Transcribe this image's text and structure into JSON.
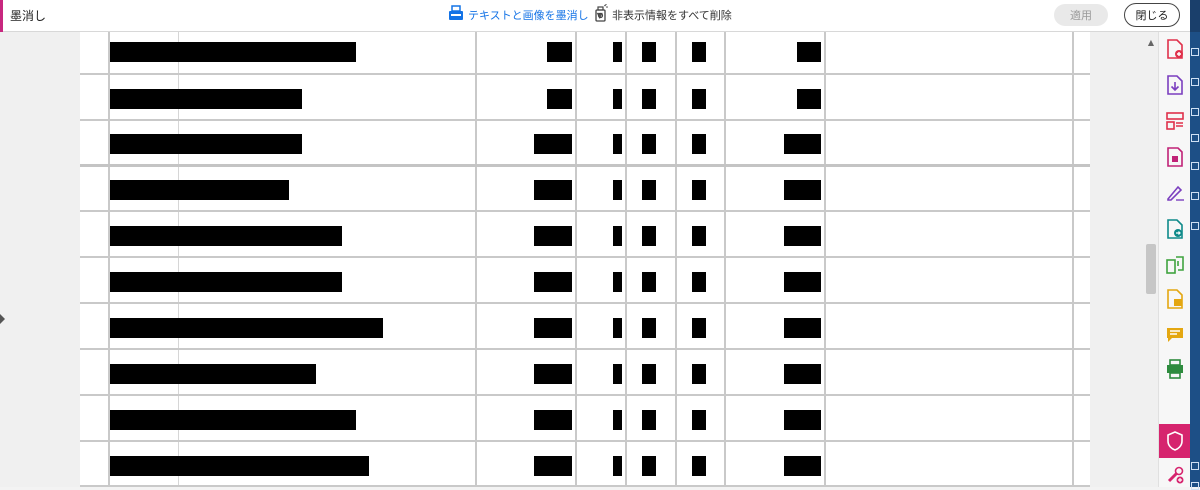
{
  "toolbar": {
    "title": "墨消し",
    "redact_text_images": "テキストと画像を墨消し",
    "remove_hidden_info": "非表示情報をすべて削除",
    "apply_label": "適用",
    "close_label": "閉じる",
    "accent_color": "#c8277f",
    "link_color": "#1473e6"
  },
  "table": {
    "row_count": 10,
    "cell_content": "redacted"
  },
  "right_rail": {
    "icons": [
      "create-pdf-icon",
      "export-pdf-icon",
      "organize-pages-icon",
      "compress-pdf-icon",
      "fill-sign-icon",
      "send-for-review-icon",
      "edit-pdf-icon",
      "comment-icon",
      "print-production-icon",
      "protect-icon",
      "redact-icon",
      "more-tools-icon"
    ],
    "active_icon": "redact-icon",
    "active_color": "#d6246e"
  }
}
